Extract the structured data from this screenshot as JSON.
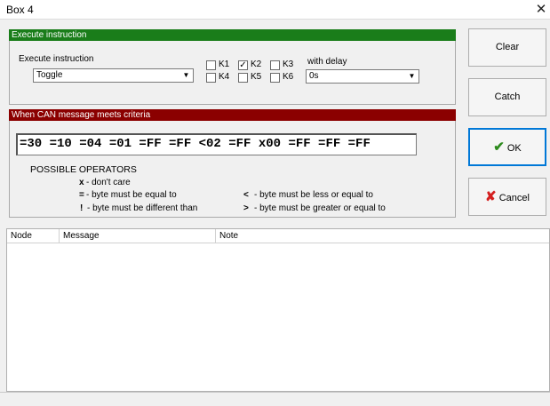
{
  "window": {
    "title": "Box 4",
    "close_glyph": "✕"
  },
  "execute": {
    "header": "Execute instruction",
    "label": "Execute instruction",
    "instruction_value": "Toggle",
    "relays": [
      {
        "label": "K1",
        "checked": false
      },
      {
        "label": "K2",
        "checked": true
      },
      {
        "label": "K3",
        "checked": false
      },
      {
        "label": "K4",
        "checked": false
      },
      {
        "label": "K5",
        "checked": false
      },
      {
        "label": "K6",
        "checked": false
      }
    ],
    "delay_label": "with delay",
    "delay_value": "0s"
  },
  "criteria": {
    "header": "When CAN message meets criteria",
    "value": "=30 =10 =04 =01 =FF =FF <02 =FF x00 =FF =FF =FF",
    "operators_title": "POSSIBLE OPERATORS",
    "operators": [
      {
        "symbol": "x",
        "text": "- don't care"
      },
      {
        "symbol": "=",
        "text": "- byte must be equal to"
      },
      {
        "symbol": "!",
        "text": "- byte must be different than"
      },
      {
        "symbol": "<",
        "text": "- byte must be less or equal to"
      },
      {
        "symbol": ">",
        "text": "- byte must be greater or equal to"
      }
    ]
  },
  "buttons": {
    "clear": "Clear",
    "catch": "Catch",
    "ok": "OK",
    "cancel": "Cancel"
  },
  "colors": {
    "execute_header": "#1a7d1a",
    "criteria_header": "#8b0000",
    "ok_icon": "#2e8b1e",
    "cancel_icon": "#d42020"
  },
  "table": {
    "columns": [
      "Node",
      "Message",
      "Note"
    ],
    "rows": []
  }
}
